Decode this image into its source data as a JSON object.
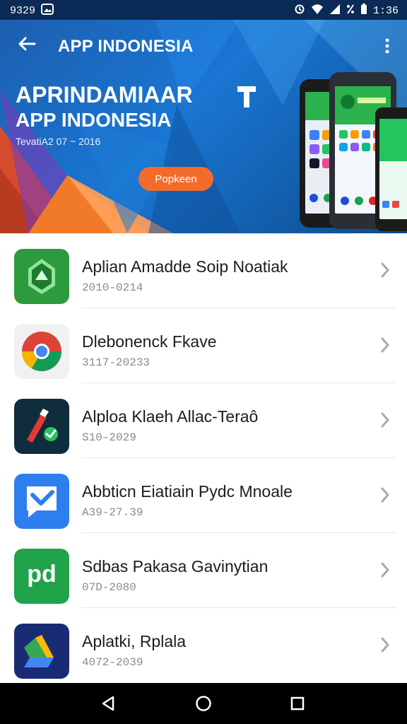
{
  "status_bar": {
    "left_time": "9329",
    "right_time": "1:36"
  },
  "toolbar": {
    "title": "APP INDONESIA"
  },
  "hero": {
    "headline": "APRINDAMIAAR",
    "subheadline": "APP INDONESIA",
    "date": "Tevati​A2 07 ~ 2016",
    "cta_label": "Popkeen"
  },
  "list": {
    "items": [
      {
        "name": "Aplian Amadde Soip Noatiak",
        "sub": "2010-0214",
        "icon": "green-shield-app-icon",
        "color": "#2e9a3e"
      },
      {
        "name": "Dlebonenck Fkave",
        "sub": "3117-20233",
        "icon": "chrome-like-app-icon",
        "color": "#f1f1f1"
      },
      {
        "name": "Alploa Klaeh Allac-Teraô",
        "sub": "S10–2029",
        "icon": "red-pen-app-icon",
        "color": "#0f2d3c"
      },
      {
        "name": "Abbticn Eiatiain Pydc Mnoale",
        "sub": "A39-27.39",
        "icon": "blue-chat-app-icon",
        "color": "#2d7ff0"
      },
      {
        "name": "Sdbas Pakasa Gavinytian",
        "sub": "07D-2080",
        "icon": "pd-app-icon",
        "color": "#20a34a"
      },
      {
        "name": "Aplatki, Rplala",
        "sub": "4072-2039",
        "icon": "drive-app-icon",
        "color": "#1a2b75"
      }
    ]
  },
  "nav": {
    "back_icon": "back-triangle-icon",
    "home_icon": "home-circle-icon",
    "recents_icon": "recents-square-icon"
  }
}
